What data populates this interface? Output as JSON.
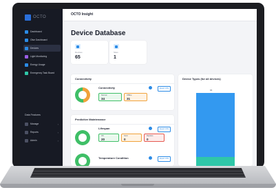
{
  "app": {
    "logo_text": "OCTO",
    "header_title": "OCTO Insight"
  },
  "sidebar": {
    "items": [
      {
        "label": "Dashboard",
        "icon": "dashboard-icon",
        "color": "#2b8be6"
      },
      {
        "label": "Olse Dashboard",
        "icon": "grid-icon",
        "color": "#2b8be6"
      },
      {
        "label": "Devices",
        "icon": "device-icon",
        "color": "#2b8be6",
        "active": true
      },
      {
        "label": "Light Monitoring",
        "icon": "light-icon",
        "color": "#9b5de5"
      },
      {
        "label": "Energy Usage",
        "icon": "energy-icon",
        "color": "#2b8be6"
      },
      {
        "label": "Emergency Task Board",
        "icon": "alert-icon",
        "color": "#2fc7a8"
      }
    ],
    "data_features_title": "Data Features",
    "data_features": [
      {
        "label": "Manage",
        "icon": "manage-icon"
      },
      {
        "label": "Reports",
        "icon": "reports-icon"
      },
      {
        "label": "Admin",
        "icon": "admin-icon"
      }
    ]
  },
  "page": {
    "title": "Device Database"
  },
  "stats": [
    {
      "label": "Devices",
      "value": "65",
      "icon": "device-icon"
    },
    {
      "label": "Sites",
      "value": "1",
      "icon": "site-icon"
    }
  ],
  "connectivity": {
    "title": "Connectivity",
    "metric_title": "Connectivity",
    "export_label": "Export CSV",
    "donut_colors": [
      "#f0a23b",
      "#3fbf67"
    ],
    "donut_fraction_orange": 0.48,
    "chips": [
      {
        "label": "Normal",
        "value": "34",
        "style": "green"
      },
      {
        "label": "Offline",
        "value": "31",
        "style": "orange"
      }
    ]
  },
  "maintenance": {
    "title": "Predictive Maintenance",
    "lifespan_title": "Lifespan",
    "export_label": "Export CSV",
    "chips": [
      {
        "label": "OK",
        "value": "20",
        "style": "green"
      },
      {
        "label": "Soon",
        "value": "0",
        "style": "orange"
      },
      {
        "label": "Replace",
        "value": "0",
        "style": "red"
      }
    ],
    "temp_title": "Temperature Condition",
    "temp_export_label": "Export CSV"
  },
  "device_types": {
    "title": "Device Types (for all devices)",
    "bar_label": "65",
    "colors": [
      "#3399f0",
      "#2fc7a8"
    ]
  }
}
